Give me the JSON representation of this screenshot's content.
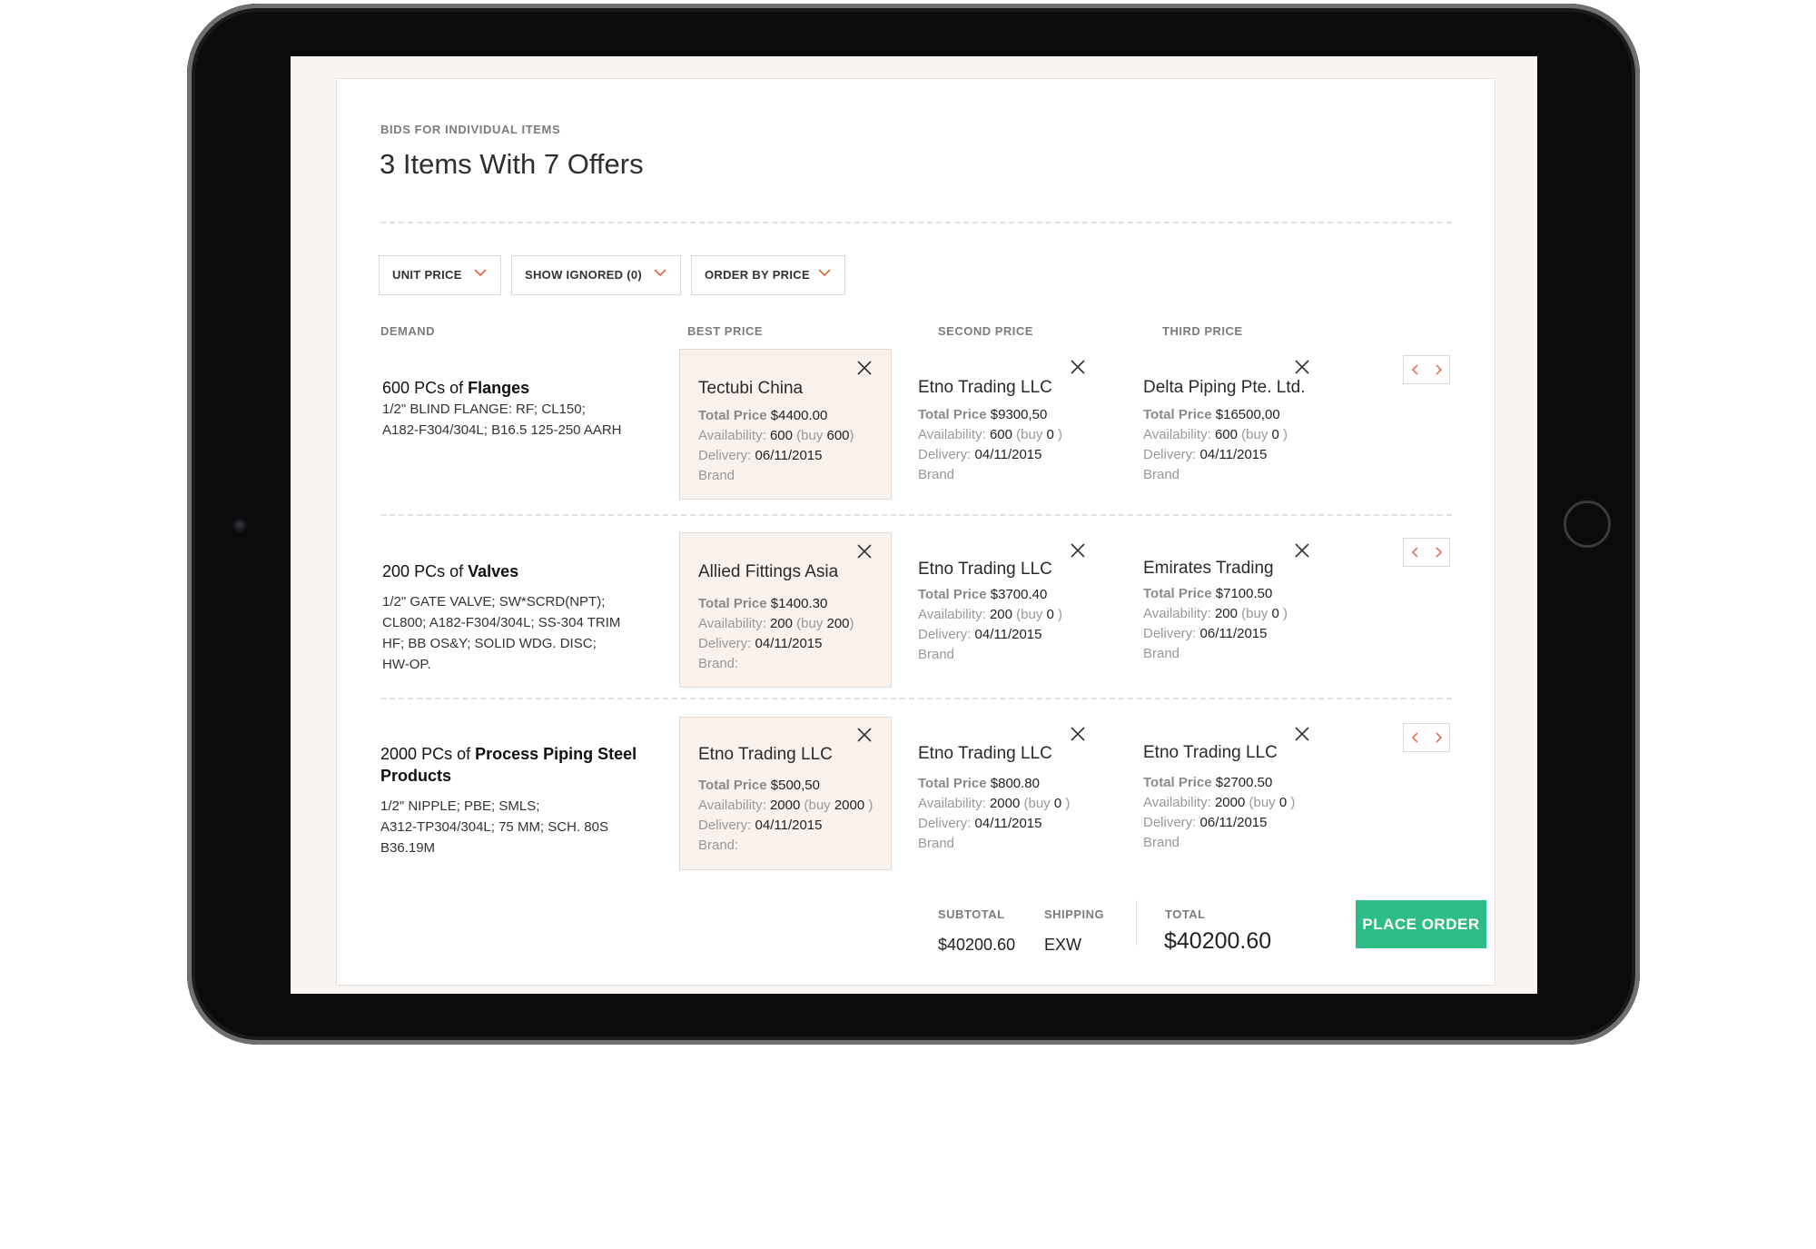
{
  "header": {
    "eyebrow": "BIDS FOR INDIVIDUAL ITEMS",
    "title": "3 Items With 7 Offers"
  },
  "filters": [
    "UNIT PRICE",
    "SHOW IGNORED (0)",
    "ORDER BY PRICE"
  ],
  "columns": {
    "demand": "DEMAND",
    "best": "BEST PRICE",
    "second": "SECOND PRICE",
    "third": "THIRD PRICE"
  },
  "labels": {
    "total_price": "Total Price",
    "availability": "Availability:",
    "buy_open": "(buy",
    "buy_close": ")",
    "delivery": "Delivery:"
  },
  "rows": [
    {
      "qty": "600",
      "unit": "PCs of",
      "item": "Flanges",
      "desc": [
        "1/2\"  BLIND FLANGE: RF; CL150;",
        "A182-F304/304L; B16.5 125-250 AARH"
      ],
      "offers": [
        {
          "vendor": "Tectubi China",
          "total": "$4400.00",
          "avail": "600",
          "buy": "600",
          "delivery": "06/11/2015",
          "brand": "Brand"
        },
        {
          "vendor": "Etno Trading LLC",
          "total": "$9300,50",
          "avail": "600",
          "buy": "0",
          "delivery": "04/11/2015",
          "brand": "Brand"
        },
        {
          "vendor": "Delta Piping Pte. Ltd.",
          "total": "$16500,00",
          "avail": "600",
          "buy": "0",
          "delivery": "04/11/2015",
          "brand": "Brand"
        }
      ]
    },
    {
      "qty": "200",
      "unit": "PCs of",
      "item": "Valves",
      "desc": [
        "1/2\" GATE VALVE; SW*SCRD(NPT);",
        "CL800; A182-F304/304L; SS-304 TRIM",
        "HF; BB OS&Y; SOLID WDG. DISC;",
        "HW-OP."
      ],
      "offers": [
        {
          "vendor": "Allied Fittings Asia",
          "total": "$1400.30",
          "avail": "200",
          "buy": "200",
          "delivery": "04/11/2015",
          "brand": "Brand:"
        },
        {
          "vendor": "Etno Trading LLC",
          "total": "$3700.40",
          "avail": "200",
          "buy": "0",
          "delivery": "04/11/2015",
          "brand": "Brand"
        },
        {
          "vendor": "Emirates Trading",
          "total": "$7100.50",
          "avail": "200",
          "buy": "0",
          "delivery": "06/11/2015",
          "brand": "Brand"
        }
      ]
    },
    {
      "qty": "2000",
      "unit": "PCs of",
      "item": "Process Piping Steel",
      "item2": "Products",
      "desc": [
        "1/2\" NIPPLE; PBE; SMLS;",
        "A312-TP304/304L; 75 MM; SCH. 80S",
        "B36.19M"
      ],
      "offers": [
        {
          "vendor": "Etno Trading LLC",
          "total": "$500,50",
          "avail": "2000",
          "buy": "2000",
          "delivery": "04/11/2015",
          "brand": "Brand:"
        },
        {
          "vendor": "Etno Trading LLC",
          "total": "$800.80",
          "avail": "2000",
          "buy": "0",
          "delivery": "04/11/2015",
          "brand": "Brand"
        },
        {
          "vendor": "Etno Trading LLC",
          "total": "$2700.50",
          "avail": "2000",
          "buy": "0",
          "delivery": "06/11/2015",
          "brand": "Brand"
        }
      ]
    }
  ],
  "totals": {
    "subtotal_label": "SUBTOTAL",
    "subtotal": "$40200.60",
    "shipping_label": "SHIPPING",
    "shipping": "EXW",
    "total_label": "TOTAL",
    "total": "$40200.60",
    "button": "PLACE ORDER"
  },
  "colors": {
    "accent": "#e8623a",
    "button": "#2ebd86"
  }
}
